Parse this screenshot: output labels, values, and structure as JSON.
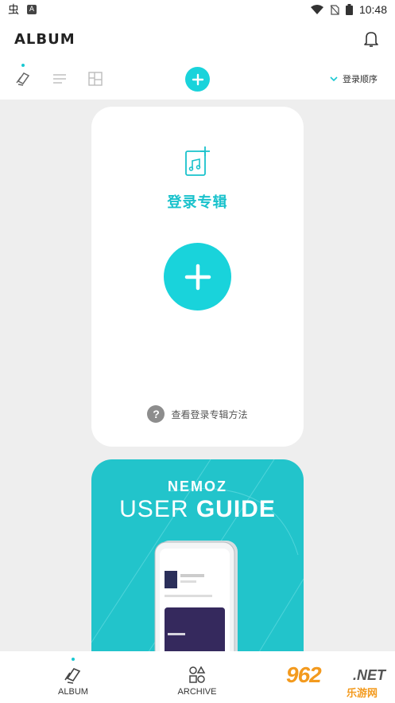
{
  "status_bar": {
    "time": "10:48",
    "notif_glyph": "虫",
    "keyboard_glyph": "A"
  },
  "header": {
    "title": "ALBUM"
  },
  "toolbar": {
    "sort_label": "登录顺序"
  },
  "register_card": {
    "title": "登录专辑",
    "help_glyph": "?",
    "help_text": "查看登录专辑方法"
  },
  "guide_card": {
    "brand": "NEMOZ",
    "title_regular": "USER ",
    "title_bold": "GUIDE"
  },
  "bottom_nav": {
    "items": [
      {
        "label": "ALBUM",
        "icon": "album-icon",
        "active": true
      },
      {
        "label": "ARCHIVE",
        "icon": "archive-icon",
        "active": false
      }
    ]
  },
  "watermark": {
    "number": "962",
    "suffix": ".NET",
    "sub": "乐游网"
  },
  "colors": {
    "accent": "#19d3db",
    "accent_text": "#19c2cc",
    "guide_bg": "#22c4cb"
  }
}
